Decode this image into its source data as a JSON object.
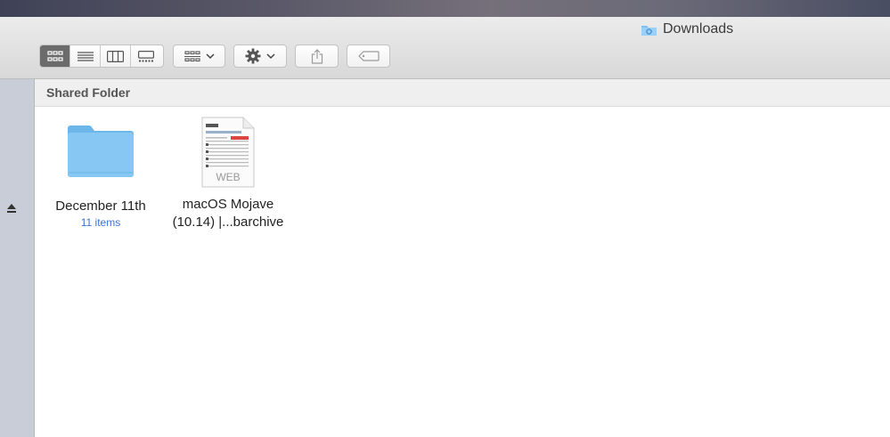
{
  "window": {
    "title": "Downloads",
    "title_icon": "folder-icon"
  },
  "toolbar": {
    "view_buttons": [
      "icon-view",
      "list-view",
      "column-view",
      "gallery-view"
    ],
    "active_view": "icon-view",
    "group_icon": "group-by-icon",
    "action_icon": "gear-icon",
    "share_icon": "share-icon",
    "tag_icon": "tag-icon"
  },
  "path": {
    "label": "Shared Folder"
  },
  "files": [
    {
      "name": "December 11th",
      "detail": "11 items",
      "icon": "folder-icon"
    },
    {
      "name_line1": "macOS Mojave",
      "name_line2": "(10.14) |...barchive",
      "badge": "WEB",
      "icon": "webarchive-icon"
    }
  ],
  "colors": {
    "accent": "#3b73d8",
    "folder": "#7fc2f0",
    "sidebar": "#c9cdd8"
  }
}
